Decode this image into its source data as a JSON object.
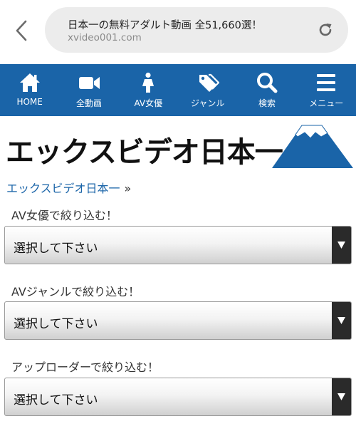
{
  "browser": {
    "title": "日本一の無料アダルト動画 全51,660選！",
    "url": "xvideo001.com"
  },
  "nav": {
    "items": [
      {
        "label": "HOME",
        "icon": "home-icon"
      },
      {
        "label": "全動画",
        "icon": "video-camera-icon"
      },
      {
        "label": "AV女優",
        "icon": "person-icon"
      },
      {
        "label": "ジャンル",
        "icon": "tags-icon"
      },
      {
        "label": "検索",
        "icon": "search-icon"
      },
      {
        "label": "メニュー",
        "icon": "hamburger-menu-icon"
      }
    ]
  },
  "logo": {
    "text": "エックスビデオ日本一",
    "colors": {
      "red_dot": "#d0021b",
      "fuji_blue": "#1a64a8"
    }
  },
  "breadcrumb": {
    "link": "エックスビデオ日本一",
    "separator": "»"
  },
  "filters": [
    {
      "label": "AV女優で絞り込む！",
      "selected": "選択して下さい"
    },
    {
      "label": "AVジャンルで絞り込む！",
      "selected": "選択して下さい"
    },
    {
      "label": "アップローダーで絞り込む！",
      "selected": "選択して下さい"
    }
  ],
  "colors": {
    "nav_bg": "#1a64a8",
    "link": "#1a64a8"
  }
}
